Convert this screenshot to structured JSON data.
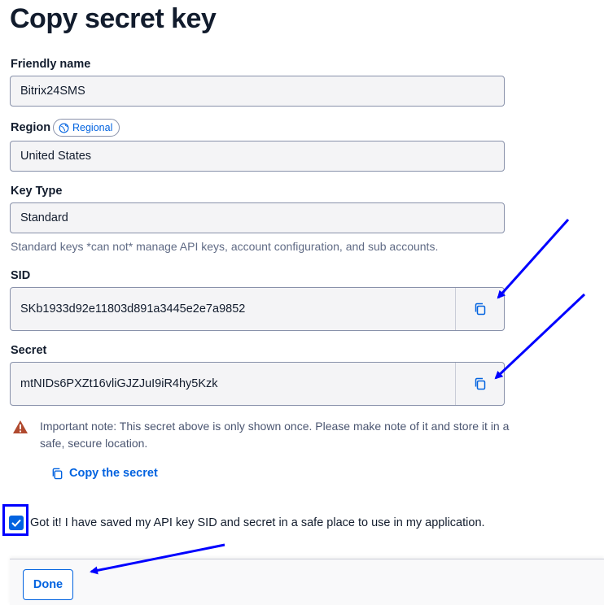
{
  "page_title": "Copy secret key",
  "friendly_name": {
    "label": "Friendly name",
    "value": "Bitrix24SMS"
  },
  "region": {
    "label": "Region",
    "badge": "Regional",
    "value": "United States"
  },
  "key_type": {
    "label": "Key Type",
    "value": "Standard",
    "help": "Standard keys *can not* manage API keys, account configuration, and sub accounts."
  },
  "sid": {
    "label": "SID",
    "value": "SKb1933d92e11803d891a3445e2e7a9852"
  },
  "secret": {
    "label": "Secret",
    "value": "mtNIDs6PXZt16vliGJZJuI9iR4hy5Kzk"
  },
  "note": "Important note: This secret above is only shown once. Please make note of it and store it in a safe, secure location.",
  "copy_secret_link": "Copy the secret",
  "confirm": {
    "label": "Got it! I have saved my API key SID and secret in a safe place to use in my application.",
    "checked": true
  },
  "done_label": "Done",
  "colors": {
    "accent": "#0263e0",
    "annotation": "#0000ff",
    "warning": "#b04a2f"
  },
  "icons": [
    "globe-icon",
    "copy-icon",
    "warning-icon",
    "checkmark-icon"
  ]
}
